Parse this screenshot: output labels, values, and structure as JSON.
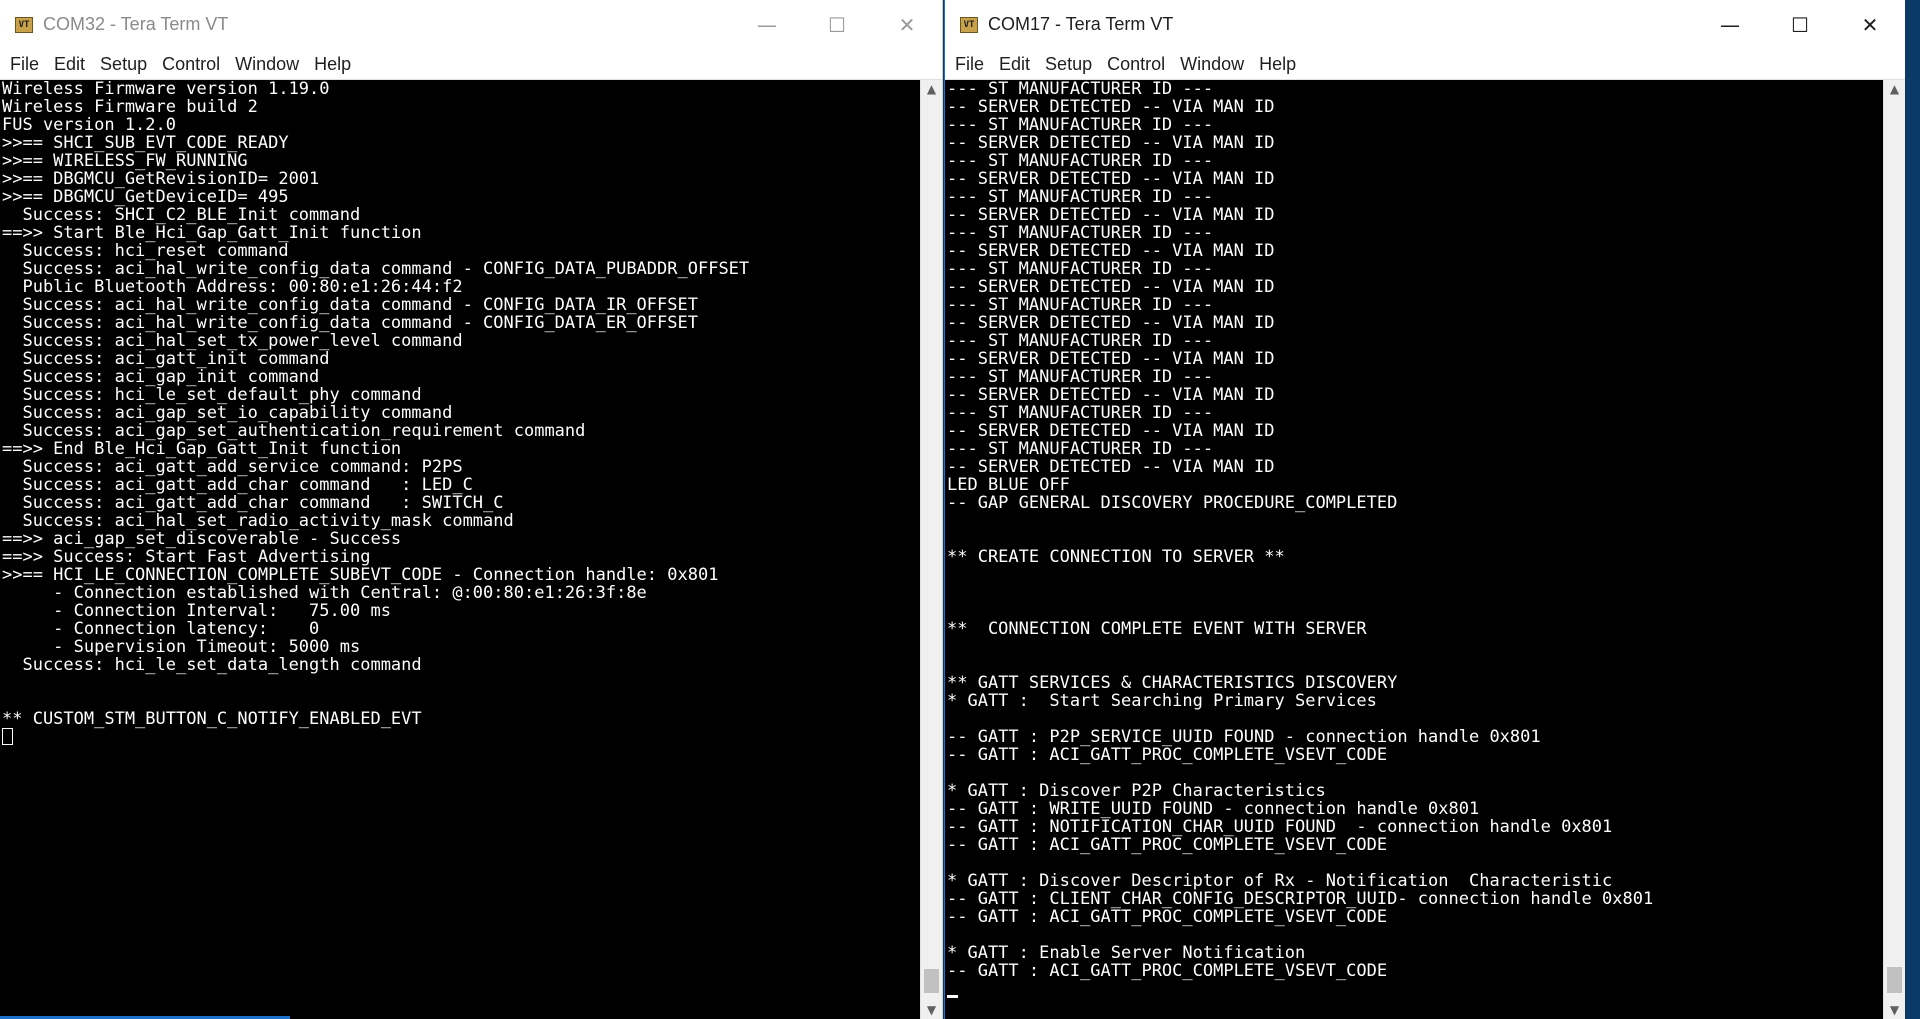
{
  "left_window": {
    "title": "COM32 - Tera Term VT",
    "icon_text": "VT",
    "menu": [
      "File",
      "Edit",
      "Setup",
      "Control",
      "Window",
      "Help"
    ],
    "lines": [
      "Wireless Firmware version 1.19.0",
      "Wireless Firmware build 2",
      "FUS version 1.2.0",
      ">>== SHCI_SUB_EVT_CODE_READY",
      ">>== WIRELESS_FW_RUNNING",
      ">>== DBGMCU_GetRevisionID= 2001",
      ">>== DBGMCU_GetDeviceID= 495",
      "  Success: SHCI_C2_BLE_Init command",
      "==>> Start Ble_Hci_Gap_Gatt_Init function",
      "  Success: hci_reset command",
      "  Success: aci_hal_write_config_data command - CONFIG_DATA_PUBADDR_OFFSET",
      "  Public Bluetooth Address: 00:80:e1:26:44:f2",
      "  Success: aci_hal_write_config_data command - CONFIG_DATA_IR_OFFSET",
      "  Success: aci_hal_write_config_data command - CONFIG_DATA_ER_OFFSET",
      "  Success: aci_hal_set_tx_power_level command",
      "  Success: aci_gatt_init command",
      "  Success: aci_gap_init command",
      "  Success: hci_le_set_default_phy command",
      "  Success: aci_gap_set_io_capability command",
      "  Success: aci_gap_set_authentication_requirement command",
      "==>> End Ble_Hci_Gap_Gatt_Init function",
      "  Success: aci_gatt_add_service command: P2PS",
      "  Success: aci_gatt_add_char command   : LED_C",
      "  Success: aci_gatt_add_char command   : SWITCH_C",
      "  Success: aci_hal_set_radio_activity_mask command",
      "==>> aci_gap_set_discoverable - Success",
      "==>> Success: Start Fast Advertising",
      ">>== HCI_LE_CONNECTION_COMPLETE_SUBEVT_CODE - Connection handle: 0x801",
      "     - Connection established with Central: @:00:80:e1:26:3f:8e",
      "     - Connection Interval:   75.00 ms",
      "     - Connection latency:    0",
      "     - Supervision Timeout: 5000 ms",
      "  Success: hci_le_set_data_length command",
      "",
      "",
      "** CUSTOM_STM_BUTTON_C_NOTIFY_ENABLED_EVT"
    ]
  },
  "right_window": {
    "title": "COM17 - Tera Term VT",
    "icon_text": "VT",
    "menu": [
      "File",
      "Edit",
      "Setup",
      "Control",
      "Window",
      "Help"
    ],
    "lines": [
      "--- ST MANUFACTURER ID ---",
      "-- SERVER DETECTED -- VIA MAN ID",
      "--- ST MANUFACTURER ID ---",
      "-- SERVER DETECTED -- VIA MAN ID",
      "--- ST MANUFACTURER ID ---",
      "-- SERVER DETECTED -- VIA MAN ID",
      "--- ST MANUFACTURER ID ---",
      "-- SERVER DETECTED -- VIA MAN ID",
      "--- ST MANUFACTURER ID ---",
      "-- SERVER DETECTED -- VIA MAN ID",
      "--- ST MANUFACTURER ID ---",
      "-- SERVER DETECTED -- VIA MAN ID",
      "--- ST MANUFACTURER ID ---",
      "-- SERVER DETECTED -- VIA MAN ID",
      "--- ST MANUFACTURER ID ---",
      "-- SERVER DETECTED -- VIA MAN ID",
      "--- ST MANUFACTURER ID ---",
      "-- SERVER DETECTED -- VIA MAN ID",
      "--- ST MANUFACTURER ID ---",
      "-- SERVER DETECTED -- VIA MAN ID",
      "--- ST MANUFACTURER ID ---",
      "-- SERVER DETECTED -- VIA MAN ID",
      "LED BLUE OFF",
      "-- GAP GENERAL DISCOVERY PROCEDURE_COMPLETED",
      "",
      "",
      "** CREATE CONNECTION TO SERVER **",
      "",
      "",
      "",
      "**  CONNECTION COMPLETE EVENT WITH SERVER",
      "",
      "",
      "** GATT SERVICES & CHARACTERISTICS DISCOVERY",
      "* GATT :  Start Searching Primary Services",
      "",
      "-- GATT : P2P_SERVICE_UUID FOUND - connection handle 0x801",
      "-- GATT : ACI_GATT_PROC_COMPLETE_VSEVT_CODE",
      "",
      "* GATT : Discover P2P Characteristics",
      "-- GATT : WRITE_UUID FOUND - connection handle 0x801",
      "-- GATT : NOTIFICATION_CHAR_UUID FOUND  - connection handle 0x801",
      "-- GATT : ACI_GATT_PROC_COMPLETE_VSEVT_CODE",
      "",
      "* GATT : Discover Descriptor of Rx - Notification  Characteristic",
      "-- GATT : CLIENT_CHAR_CONFIG_DESCRIPTOR_UUID- connection handle 0x801",
      "-- GATT : ACI_GATT_PROC_COMPLETE_VSEVT_CODE",
      "",
      "* GATT : Enable Server Notification",
      "-- GATT : ACI_GATT_PROC_COMPLETE_VSEVT_CODE"
    ]
  },
  "controls": {
    "minimize": "—",
    "maximize": "☐",
    "close": "✕",
    "scroll_up": "▲",
    "scroll_down": "▼"
  }
}
